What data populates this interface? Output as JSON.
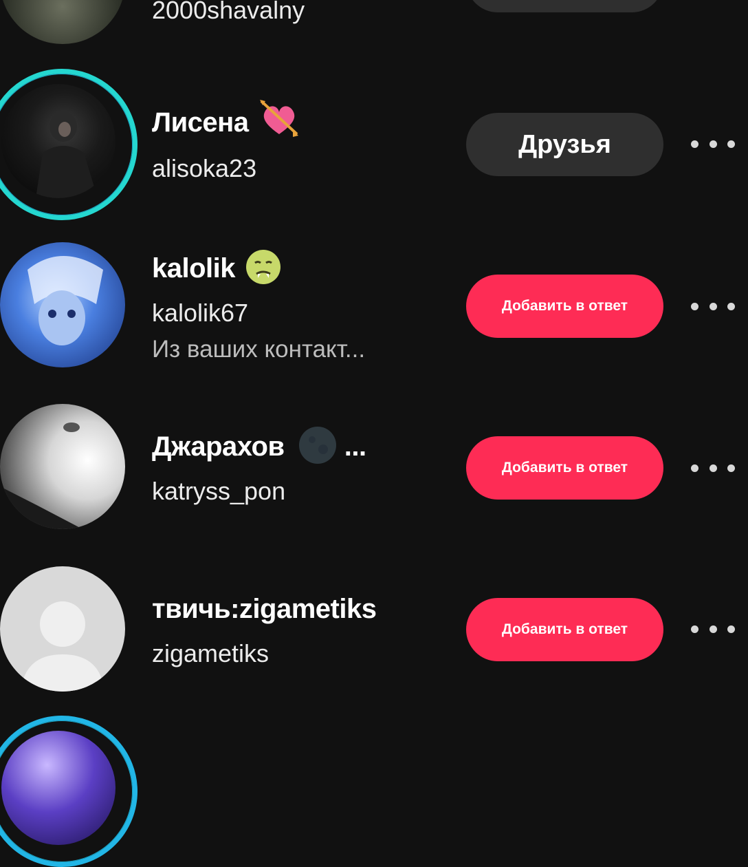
{
  "users": [
    {
      "display_name": "",
      "username": "2000shavalny",
      "subtitle": "",
      "button": "",
      "button_style": "grey"
    },
    {
      "display_name": "Лисена",
      "username": "alisoka23",
      "subtitle": "",
      "button": "Друзья",
      "button_style": "grey",
      "emoji": "heart-with-arrow-icon"
    },
    {
      "display_name": "kalolik",
      "username": "kalolik67",
      "subtitle": "Из ваших контакт...",
      "button": "Добавить в ответ",
      "button_style": "pink",
      "emoji": "woozy-face-icon"
    },
    {
      "display_name": "Джарахов",
      "display_suffix": "...",
      "username": "katryss_pon",
      "subtitle": "",
      "button": "Добавить в ответ",
      "button_style": "pink",
      "emoji": "new-moon-icon"
    },
    {
      "display_name": "твичь:zigametiks",
      "username": "zigametiks",
      "subtitle": "",
      "button": "Добавить в ответ",
      "button_style": "pink"
    }
  ],
  "colors": {
    "background": "#111111",
    "follow_button": "#fe2c55",
    "friends_button": "#2f2f2f",
    "story_ring": "#25d7d0"
  }
}
